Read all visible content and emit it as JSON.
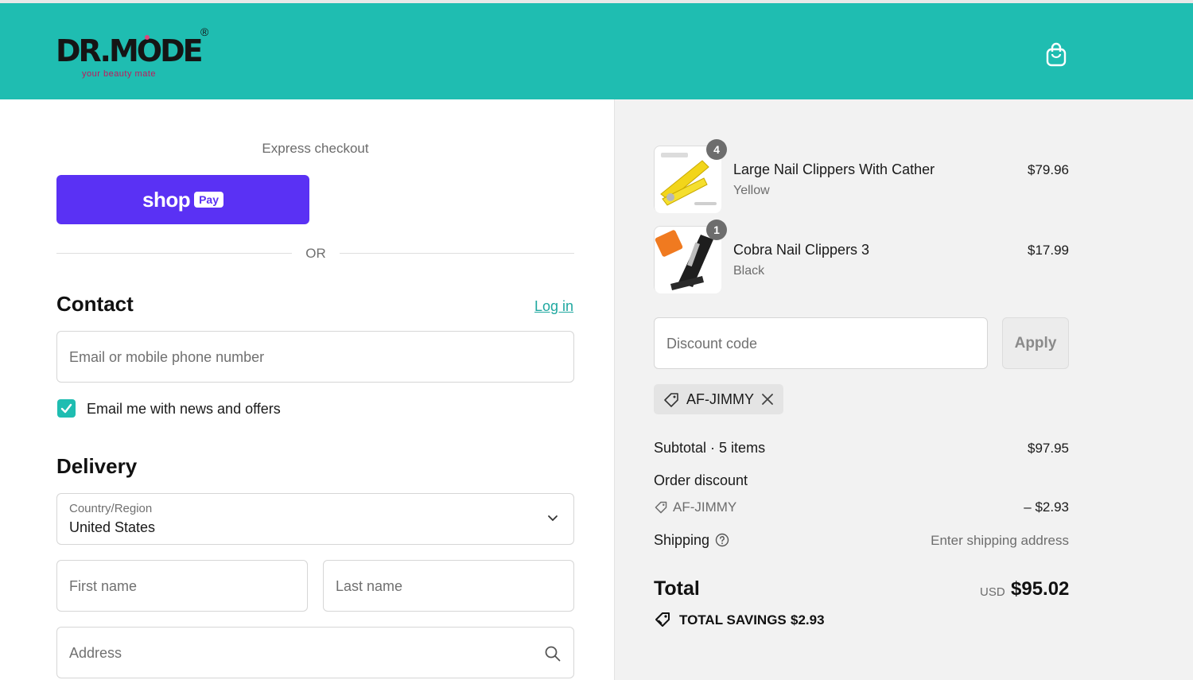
{
  "header": {
    "logo_text": "DR.MODE",
    "logo_registered": "®",
    "logo_tagline": "your beauty mate",
    "cart_icon": "shopping-bag-icon",
    "bg_color": "#1fbdb1"
  },
  "express": {
    "label": "Express checkout",
    "shoppay_shop": "shop",
    "shoppay_pay": "Pay",
    "or": "OR"
  },
  "contact": {
    "title": "Contact",
    "login": "Log in",
    "email_placeholder": "Email or mobile phone number",
    "newsletter_label": "Email me with news and offers",
    "newsletter_checked": true
  },
  "delivery": {
    "title": "Delivery",
    "country_label": "Country/Region",
    "country_value": "United States",
    "first_name_placeholder": "First name",
    "last_name_placeholder": "Last name",
    "address_placeholder": "Address"
  },
  "cart": {
    "items": [
      {
        "name": "Large Nail Clippers With Cather",
        "variant": "Yellow",
        "price": "$79.96",
        "quantity": "4"
      },
      {
        "name": "Cobra Nail Clippers 3",
        "variant": "Black",
        "price": "$17.99",
        "quantity": "1"
      }
    ],
    "discount_placeholder": "Discount code",
    "apply_label": "Apply",
    "applied_code": "AF-JIMMY"
  },
  "summary": {
    "subtotal_label": "Subtotal · 5 items",
    "subtotal_value": "$97.95",
    "order_discount_label": "Order discount",
    "discount_code": "AF-JIMMY",
    "discount_value": "– $2.93",
    "shipping_label": "Shipping",
    "shipping_value": "Enter shipping address",
    "total_label": "Total",
    "total_currency": "USD",
    "total_value": "$95.02",
    "savings_label": "TOTAL SAVINGS",
    "savings_value": "$2.93"
  }
}
